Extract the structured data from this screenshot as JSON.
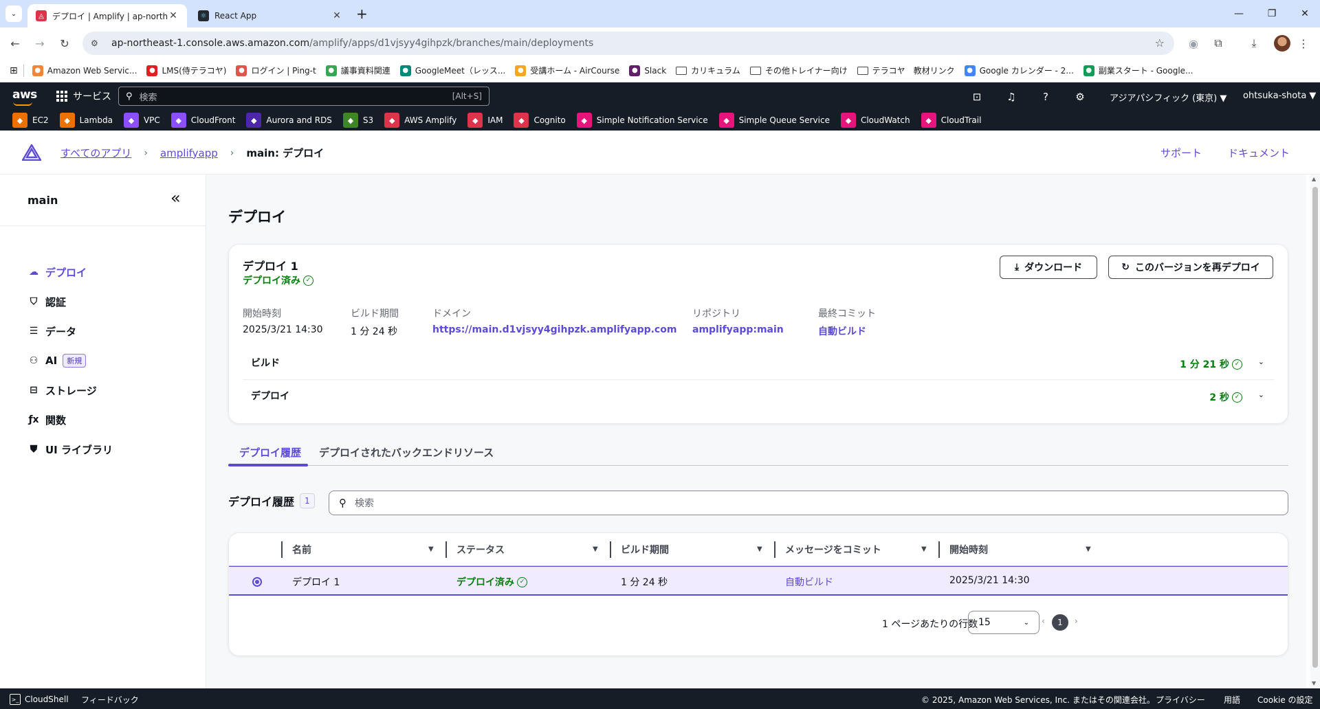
{
  "browser": {
    "tabs": [
      {
        "title": "デプロイ | Amplify | ap-northeast-1",
        "active": true
      },
      {
        "title": "React App",
        "active": false
      }
    ],
    "url_host": "ap-northeast-1.console.aws.amazon.com",
    "url_path": "/amplify/apps/d1vjsyy4gihpzk/branches/main/deployments",
    "bookmarks": [
      {
        "label": "Amazon Web Servic...",
        "type": "site",
        "color": "#f58536"
      },
      {
        "label": "LMS(侍テラコヤ)",
        "type": "site",
        "color": "#e02020"
      },
      {
        "label": "ログイン | Ping-t",
        "type": "site",
        "color": "#e0554a"
      },
      {
        "label": "議事資料関連",
        "type": "site",
        "color": "#34a853"
      },
      {
        "label": "GoogleMeet（レッス...",
        "type": "site",
        "color": "#00897b"
      },
      {
        "label": "受講ホーム - AirCourse",
        "type": "site",
        "color": "#f6a623"
      },
      {
        "label": "Slack",
        "type": "site",
        "color": "#611f69"
      },
      {
        "label": "カリキュラム",
        "type": "folder"
      },
      {
        "label": "その他トレイナー向け",
        "type": "folder"
      },
      {
        "label": "テラコヤ　教材リンク",
        "type": "folder"
      },
      {
        "label": "Google カレンダー - 2...",
        "type": "site",
        "color": "#4285f4"
      },
      {
        "label": "副業スタート - Google...",
        "type": "site",
        "color": "#0f9d58"
      }
    ]
  },
  "aws": {
    "logo": "aws",
    "services": "サービス",
    "search_placeholder": "検索",
    "search_shortcut": "[Alt+S]",
    "region": "アジアパシフィック (東京) ▼",
    "user": "ohtsuka-shota ▼",
    "favorites": [
      {
        "label": "EC2",
        "color": "#ed7100"
      },
      {
        "label": "Lambda",
        "color": "#ed7100"
      },
      {
        "label": "VPC",
        "color": "#8c4fff"
      },
      {
        "label": "CloudFront",
        "color": "#8c4fff"
      },
      {
        "label": "Aurora and RDS",
        "color": "#4d27aa"
      },
      {
        "label": "S3",
        "color": "#3f8624"
      },
      {
        "label": "AWS Amplify",
        "color": "#dd344c"
      },
      {
        "label": "IAM",
        "color": "#dd344c"
      },
      {
        "label": "Cognito",
        "color": "#dd344c"
      },
      {
        "label": "Simple Notification Service",
        "color": "#e7157b"
      },
      {
        "label": "Simple Queue Service",
        "color": "#e7157b"
      },
      {
        "label": "CloudWatch",
        "color": "#e7157b"
      },
      {
        "label": "CloudTrail",
        "color": "#e7157b"
      }
    ]
  },
  "header": {
    "breadcrumbs": [
      "すべてのアプリ",
      "amplifyapp"
    ],
    "current": "main: デプロイ",
    "support": "サポート",
    "docs": "ドキュメント"
  },
  "sidebar": {
    "title": "main",
    "items": [
      {
        "label": "デプロイ",
        "icon": "cloud-icon",
        "glyph": "☁",
        "active": true
      },
      {
        "label": "認証",
        "icon": "shield-icon",
        "glyph": "⛉"
      },
      {
        "label": "データ",
        "icon": "database-icon",
        "glyph": "☰"
      },
      {
        "label": "AI",
        "icon": "brain-icon",
        "glyph": "⚇",
        "badge": "新規"
      },
      {
        "label": "ストレージ",
        "icon": "storage-icon",
        "glyph": "⊟"
      },
      {
        "label": "関数",
        "icon": "function-icon",
        "glyph": "ƒx"
      },
      {
        "label": "UI ライブラリ",
        "icon": "ui-library-icon",
        "glyph": "⛊"
      }
    ]
  },
  "main": {
    "title": "デプロイ",
    "deployment": {
      "name": "デプロイ 1",
      "status": "デプロイ済み",
      "download": "ダウンロード",
      "redeploy": "このバージョンを再デプロイ",
      "fields": [
        {
          "key": "開始時刻",
          "value": "2025/3/21 14:30",
          "link": false
        },
        {
          "key": "ビルド期間",
          "value": "1 分 24 秒",
          "link": false
        },
        {
          "key": "ドメイン",
          "value": "https://main.d1vjsyy4gihpzk.amplifyapp.com",
          "link": true
        },
        {
          "key": "リポジトリ",
          "value": "amplifyapp:main",
          "link": true
        },
        {
          "key": "最終コミット",
          "value": "自動ビルド",
          "link": true
        }
      ],
      "steps": [
        {
          "name": "ビルド",
          "duration": "1 分 21 秒"
        },
        {
          "name": "デプロイ",
          "duration": "2 秒"
        }
      ]
    },
    "tabs": [
      "デプロイ履歴",
      "デプロイされたバックエンドリソース"
    ],
    "history": {
      "title": "デプロイ履歴",
      "count": "1",
      "search_placeholder": "検索",
      "columns": [
        "名前",
        "ステータス",
        "ビルド期間",
        "メッセージをコミット",
        "開始時刻"
      ],
      "rows": [
        {
          "name": "デプロイ 1",
          "status": "デプロイ済み",
          "duration": "1 分 24 秒",
          "commit": "自動ビルド",
          "started": "2025/3/21 14:30"
        }
      ],
      "rows_per_page_label": "1 ページあたりの行数",
      "rows_per_page": "15",
      "page": "1"
    }
  },
  "footer": {
    "cloudshell": "CloudShell",
    "feedback": "フィードバック",
    "copyright": "© 2025, Amazon Web Services, Inc. またはその関連会社。",
    "privacy": "プライバシー",
    "terms": "用語",
    "cookies": "Cookie の設定"
  }
}
